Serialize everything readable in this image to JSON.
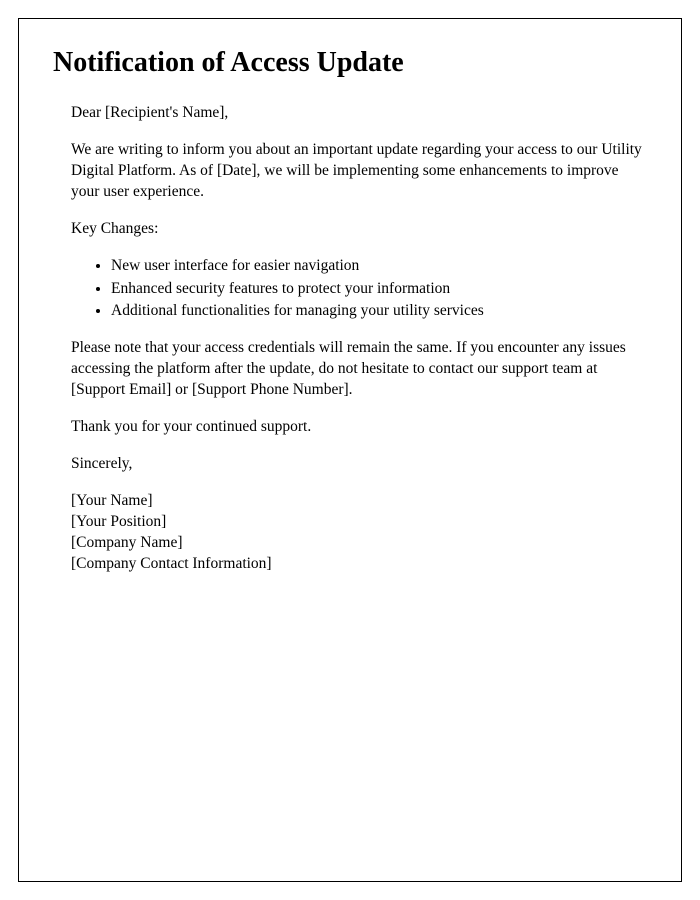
{
  "title": "Notification of Access Update",
  "salutation": "Dear [Recipient's Name],",
  "intro": "We are writing to inform you about an important update regarding your access to our Utility Digital Platform. As of [Date], we will be implementing some enhancements to improve your user experience.",
  "key_changes_label": "Key Changes:",
  "key_changes": [
    "New user interface for easier navigation",
    "Enhanced security features to protect your information",
    "Additional functionalities for managing your utility services"
  ],
  "note": "Please note that your access credentials will remain the same. If you encounter any issues accessing the platform after the update, do not hesitate to contact our support team at [Support Email] or [Support Phone Number].",
  "thanks": "Thank you for your continued support.",
  "closing": "Sincerely,",
  "signature": {
    "name": "[Your Name]",
    "position": "[Your Position]",
    "company": "[Company Name]",
    "contact": "[Company Contact Information]"
  }
}
